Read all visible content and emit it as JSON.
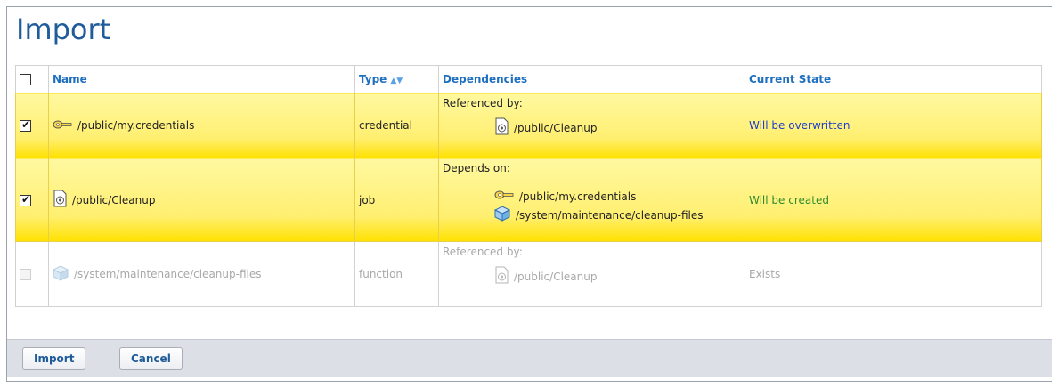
{
  "title": "Import",
  "columns": {
    "name": "Name",
    "type": "Type",
    "dependencies": "Dependencies",
    "state": "Current State"
  },
  "rows": [
    {
      "checked": true,
      "icon": "key-icon",
      "name": "/public/my.credentials",
      "type": "credential",
      "dep_header": "Referenced by:",
      "deps": [
        {
          "icon": "job-icon",
          "path": "/public/Cleanup"
        }
      ],
      "state": "Will be overwritten"
    },
    {
      "checked": true,
      "icon": "job-icon",
      "name": "/public/Cleanup",
      "type": "job",
      "dep_header": "Depends on:",
      "deps": [
        {
          "icon": "key-icon",
          "path": "/public/my.credentials"
        },
        {
          "icon": "cube-icon",
          "path": "/system/maintenance/cleanup-files"
        }
      ],
      "state": "Will be created"
    },
    {
      "checked": false,
      "icon": "cube-icon",
      "name": "/system/maintenance/cleanup-files",
      "type": "function",
      "dep_header": "Referenced by:",
      "deps": [
        {
          "icon": "job-icon",
          "path": "/public/Cleanup"
        }
      ],
      "state": "Exists"
    }
  ],
  "buttons": {
    "import": "Import",
    "cancel": "Cancel"
  },
  "colors": {
    "title": "#1f5c99",
    "header_text": "#1f6fbf",
    "selected_row": "#ffef70",
    "overwritten": "#1f3fc8",
    "created": "#2e8b2e",
    "disabled_text": "#a8a8a8"
  }
}
